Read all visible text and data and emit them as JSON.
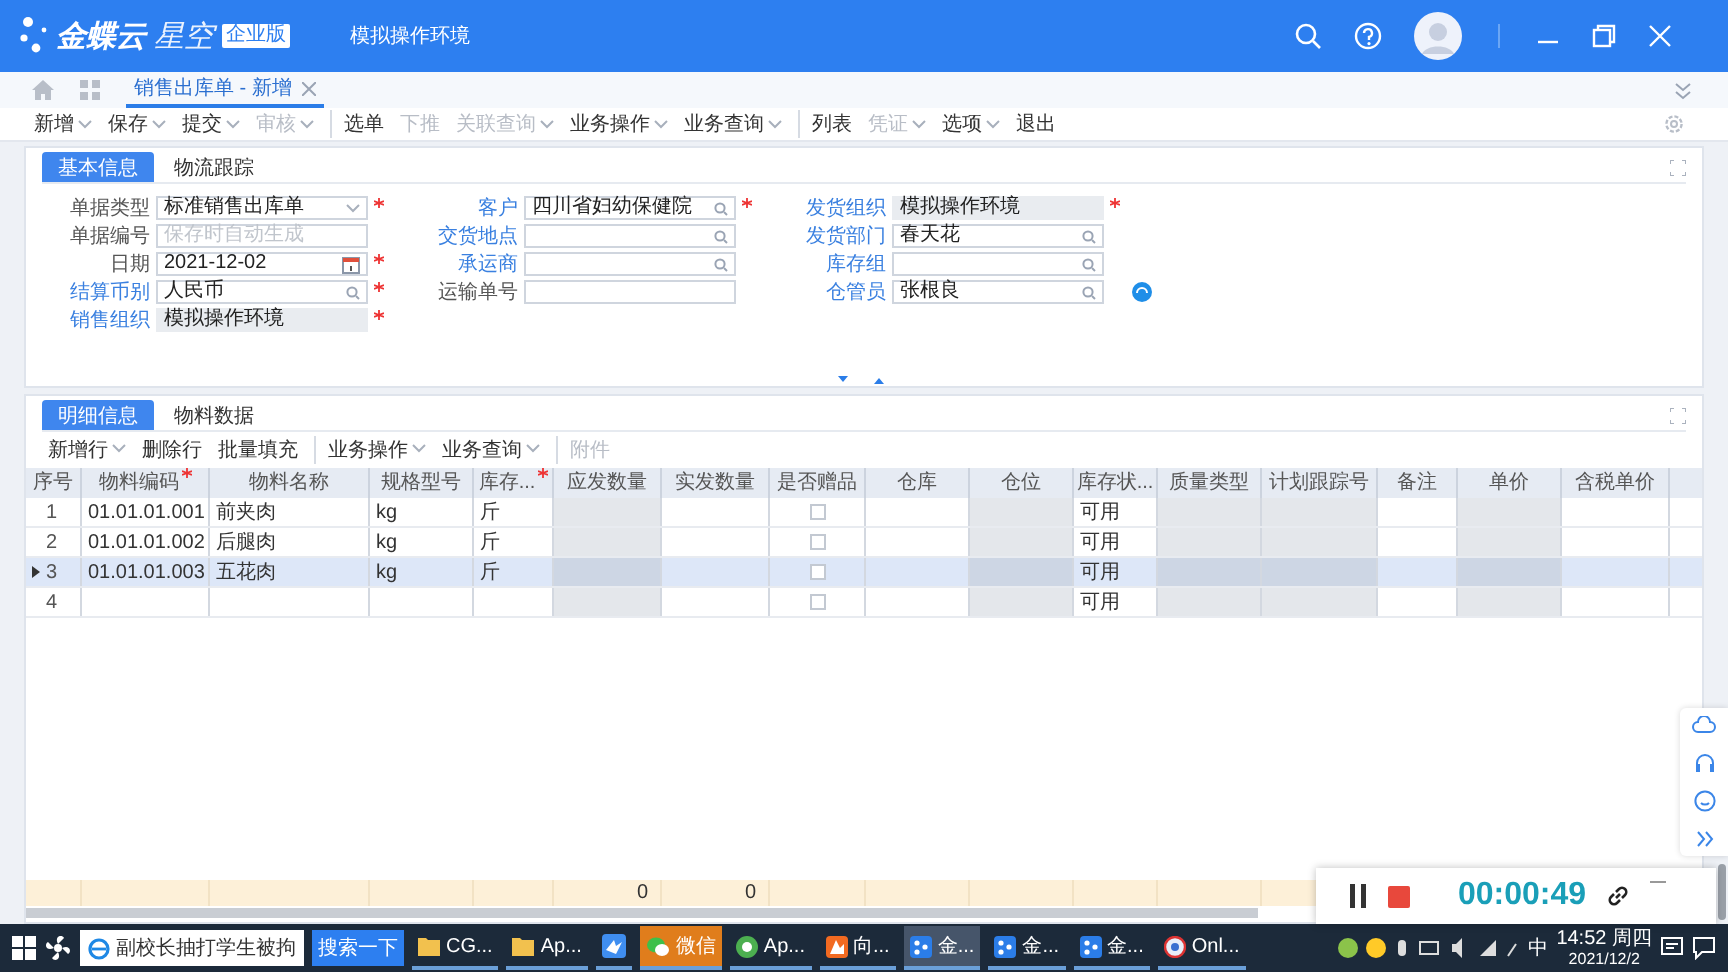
{
  "app": {
    "brand": "金蝶云",
    "product": "星空",
    "edition": "企业版",
    "environment": "模拟操作环境"
  },
  "doc_tabs": [
    {
      "label": "销售出库单 - 新增",
      "selected": true
    }
  ],
  "toolbar": [
    {
      "label": "新增",
      "dropdown": true,
      "disabled": false,
      "group_start": false
    },
    {
      "label": "保存",
      "dropdown": true,
      "disabled": false,
      "group_start": false
    },
    {
      "label": "提交",
      "dropdown": true,
      "disabled": false,
      "group_start": false
    },
    {
      "label": "审核",
      "dropdown": true,
      "disabled": true,
      "group_start": false
    },
    {
      "label": "选单",
      "dropdown": false,
      "disabled": false,
      "group_start": true
    },
    {
      "label": "下推",
      "dropdown": false,
      "disabled": true,
      "group_start": false
    },
    {
      "label": "关联查询",
      "dropdown": true,
      "disabled": true,
      "group_start": false
    },
    {
      "label": "业务操作",
      "dropdown": true,
      "disabled": false,
      "group_start": false
    },
    {
      "label": "业务查询",
      "dropdown": true,
      "disabled": false,
      "group_start": false
    },
    {
      "label": "列表",
      "dropdown": false,
      "disabled": false,
      "group_start": true
    },
    {
      "label": "凭证",
      "dropdown": true,
      "disabled": true,
      "group_start": false
    },
    {
      "label": "选项",
      "dropdown": true,
      "disabled": false,
      "group_start": false
    },
    {
      "label": "退出",
      "dropdown": false,
      "disabled": false,
      "group_start": false
    }
  ],
  "form_tabs": [
    {
      "label": "基本信息",
      "selected": true
    },
    {
      "label": "物流跟踪",
      "selected": false
    }
  ],
  "form_columns": [
    [
      {
        "label": "单据类型",
        "link": false,
        "kind": "select",
        "value": "标准销售出库单",
        "required": true
      },
      {
        "label": "单据编号",
        "link": false,
        "kind": "text",
        "placeholder": "保存时自动生成",
        "required": false
      },
      {
        "label": "日期",
        "link": false,
        "kind": "date",
        "value": "2021-12-02",
        "required": true
      },
      {
        "label": "结算币别",
        "link": true,
        "kind": "lookup",
        "value": "人民币",
        "required": true
      },
      {
        "label": "销售组织",
        "link": true,
        "kind": "readonly",
        "value": "模拟操作环境",
        "required": true
      }
    ],
    [
      {
        "label": "客户",
        "link": true,
        "kind": "lookup",
        "value": "四川省妇幼保健院",
        "required": true
      },
      {
        "label": "交货地点",
        "link": true,
        "kind": "lookup",
        "required": false
      },
      {
        "label": "承运商",
        "link": true,
        "kind": "lookup",
        "required": false
      },
      {
        "label": "运输单号",
        "link": false,
        "kind": "text",
        "required": false
      }
    ],
    [
      {
        "label": "发货组织",
        "link": true,
        "kind": "readonly",
        "value": "模拟操作环境",
        "required": true
      },
      {
        "label": "发货部门",
        "link": true,
        "kind": "lookup",
        "value": "春天花",
        "required": false
      },
      {
        "label": "库存组",
        "link": true,
        "kind": "lookup",
        "required": false
      },
      {
        "label": "仓管员",
        "link": true,
        "kind": "lookup",
        "value": "张根良",
        "required": false,
        "extra_button": true
      }
    ]
  ],
  "detail_tabs": [
    {
      "label": "明细信息",
      "selected": true
    },
    {
      "label": "物料数据",
      "selected": false
    }
  ],
  "detail_toolbar": [
    {
      "label": "新增行",
      "dropdown": true,
      "disabled": false,
      "group_start": false
    },
    {
      "label": "删除行",
      "dropdown": false,
      "disabled": false,
      "group_start": false
    },
    {
      "label": "批量填充",
      "dropdown": false,
      "disabled": false,
      "group_start": false
    },
    {
      "label": "业务操作",
      "dropdown": true,
      "disabled": false,
      "group_start": true
    },
    {
      "label": "业务查询",
      "dropdown": true,
      "disabled": false,
      "group_start": false
    },
    {
      "label": "附件",
      "dropdown": false,
      "disabled": true,
      "group_start": true
    }
  ],
  "grid": {
    "columns": [
      {
        "label": "序号",
        "kind": "text",
        "required": false,
        "readonly": false
      },
      {
        "label": "物料编码",
        "kind": "text",
        "required": true,
        "readonly": false
      },
      {
        "label": "物料名称",
        "kind": "text",
        "required": false,
        "readonly": false
      },
      {
        "label": "规格型号",
        "kind": "text",
        "required": false,
        "readonly": false
      },
      {
        "label": "库存...",
        "kind": "text",
        "required": true,
        "readonly": false
      },
      {
        "label": "应发数量",
        "kind": "text",
        "required": false,
        "readonly": true,
        "total": "0"
      },
      {
        "label": "实发数量",
        "kind": "text",
        "required": false,
        "readonly": false,
        "total": "0"
      },
      {
        "label": "是否赠品",
        "kind": "checkbox",
        "required": false,
        "readonly": false
      },
      {
        "label": "仓库",
        "kind": "text",
        "required": false,
        "readonly": false
      },
      {
        "label": "仓位",
        "kind": "text",
        "required": false,
        "readonly": true
      },
      {
        "label": "库存状...",
        "kind": "text",
        "required": false,
        "readonly": false
      },
      {
        "label": "质量类型",
        "kind": "text",
        "required": false,
        "readonly": true
      },
      {
        "label": "计划跟踪号",
        "kind": "text",
        "required": false,
        "readonly": true
      },
      {
        "label": "备注",
        "kind": "text",
        "required": false,
        "readonly": false
      },
      {
        "label": "单价",
        "kind": "text",
        "required": false,
        "readonly": true
      },
      {
        "label": "含税单价",
        "kind": "text",
        "required": false,
        "readonly": false
      }
    ],
    "rows": [
      {
        "current": false,
        "gift": false,
        "cells": [
          "1",
          "01.01.01.001",
          "前夹肉",
          "kg",
          "斤",
          null,
          null,
          null,
          null,
          null,
          "可用"
        ]
      },
      {
        "current": false,
        "gift": false,
        "cells": [
          "2",
          "01.01.01.002",
          "后腿肉",
          "kg",
          "斤",
          null,
          null,
          null,
          null,
          null,
          "可用"
        ]
      },
      {
        "current": true,
        "gift": false,
        "cells": [
          "3",
          "01.01.01.003",
          "五花肉",
          "kg",
          "斤",
          null,
          null,
          null,
          null,
          null,
          "可用"
        ]
      },
      {
        "current": false,
        "gift": false,
        "cells": [
          "4",
          null,
          null,
          null,
          null,
          null,
          null,
          null,
          null,
          null,
          "可用"
        ]
      }
    ]
  },
  "recorder": {
    "time": "00:00:49"
  },
  "taskbar": {
    "search": {
      "value": "副校长抽打学生被拘",
      "button": "搜索一下"
    },
    "apps": [
      {
        "label": "CG...",
        "kind": "folder",
        "active": false,
        "flashing": false
      },
      {
        "label": "Ap...",
        "kind": "folder",
        "active": false,
        "flashing": false
      },
      {
        "kind": "bird",
        "active": false,
        "flashing": false
      },
      {
        "label": "微信",
        "kind": "chat",
        "active": false,
        "flashing": true
      },
      {
        "label": "Ap...",
        "kind": "browser",
        "active": false,
        "flashing": false
      },
      {
        "label": "向...",
        "kind": "orange",
        "active": false,
        "flashing": false
      },
      {
        "label": "金...",
        "kind": "dots",
        "active": true,
        "flashing": false
      },
      {
        "label": "金...",
        "kind": "dots",
        "active": false,
        "flashing": false
      },
      {
        "label": "金...",
        "kind": "dots",
        "active": false,
        "flashing": false
      },
      {
        "label": "Onl...",
        "kind": "camera",
        "active": false,
        "flashing": false
      }
    ],
    "ime": "中",
    "time": "14:52 周四",
    "date": "2021/12/2"
  }
}
